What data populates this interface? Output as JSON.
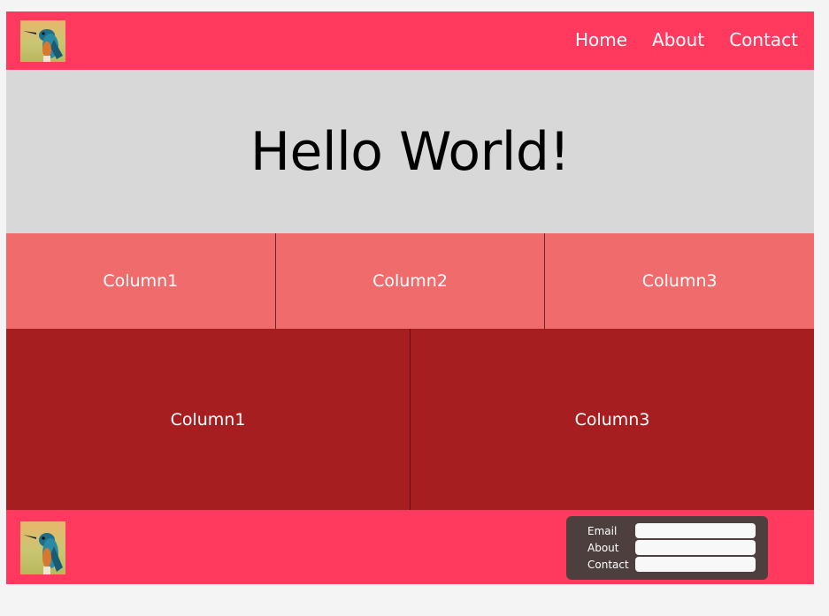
{
  "header": {
    "logo_icon": "kingfisher-bird-image",
    "nav": [
      "Home",
      "About",
      "Contact"
    ]
  },
  "hero": {
    "title": "Hello World!"
  },
  "row_three": {
    "columns": [
      "Column1",
      "Column2",
      "Column3"
    ]
  },
  "row_two": {
    "columns": [
      "Column1",
      "Column3"
    ]
  },
  "footer": {
    "logo_icon": "kingfisher-bird-image",
    "form": {
      "fields": [
        {
          "label": "Email",
          "value": ""
        },
        {
          "label": "About",
          "value": ""
        },
        {
          "label": "Contact",
          "value": ""
        }
      ]
    }
  },
  "colors": {
    "header_bg": "#ff3a5e",
    "hero_bg": "#d8d8d8",
    "row_three_bg": "#f06b6b",
    "row_two_bg": "#a61e20",
    "form_box_bg": "#4e3f3f"
  }
}
